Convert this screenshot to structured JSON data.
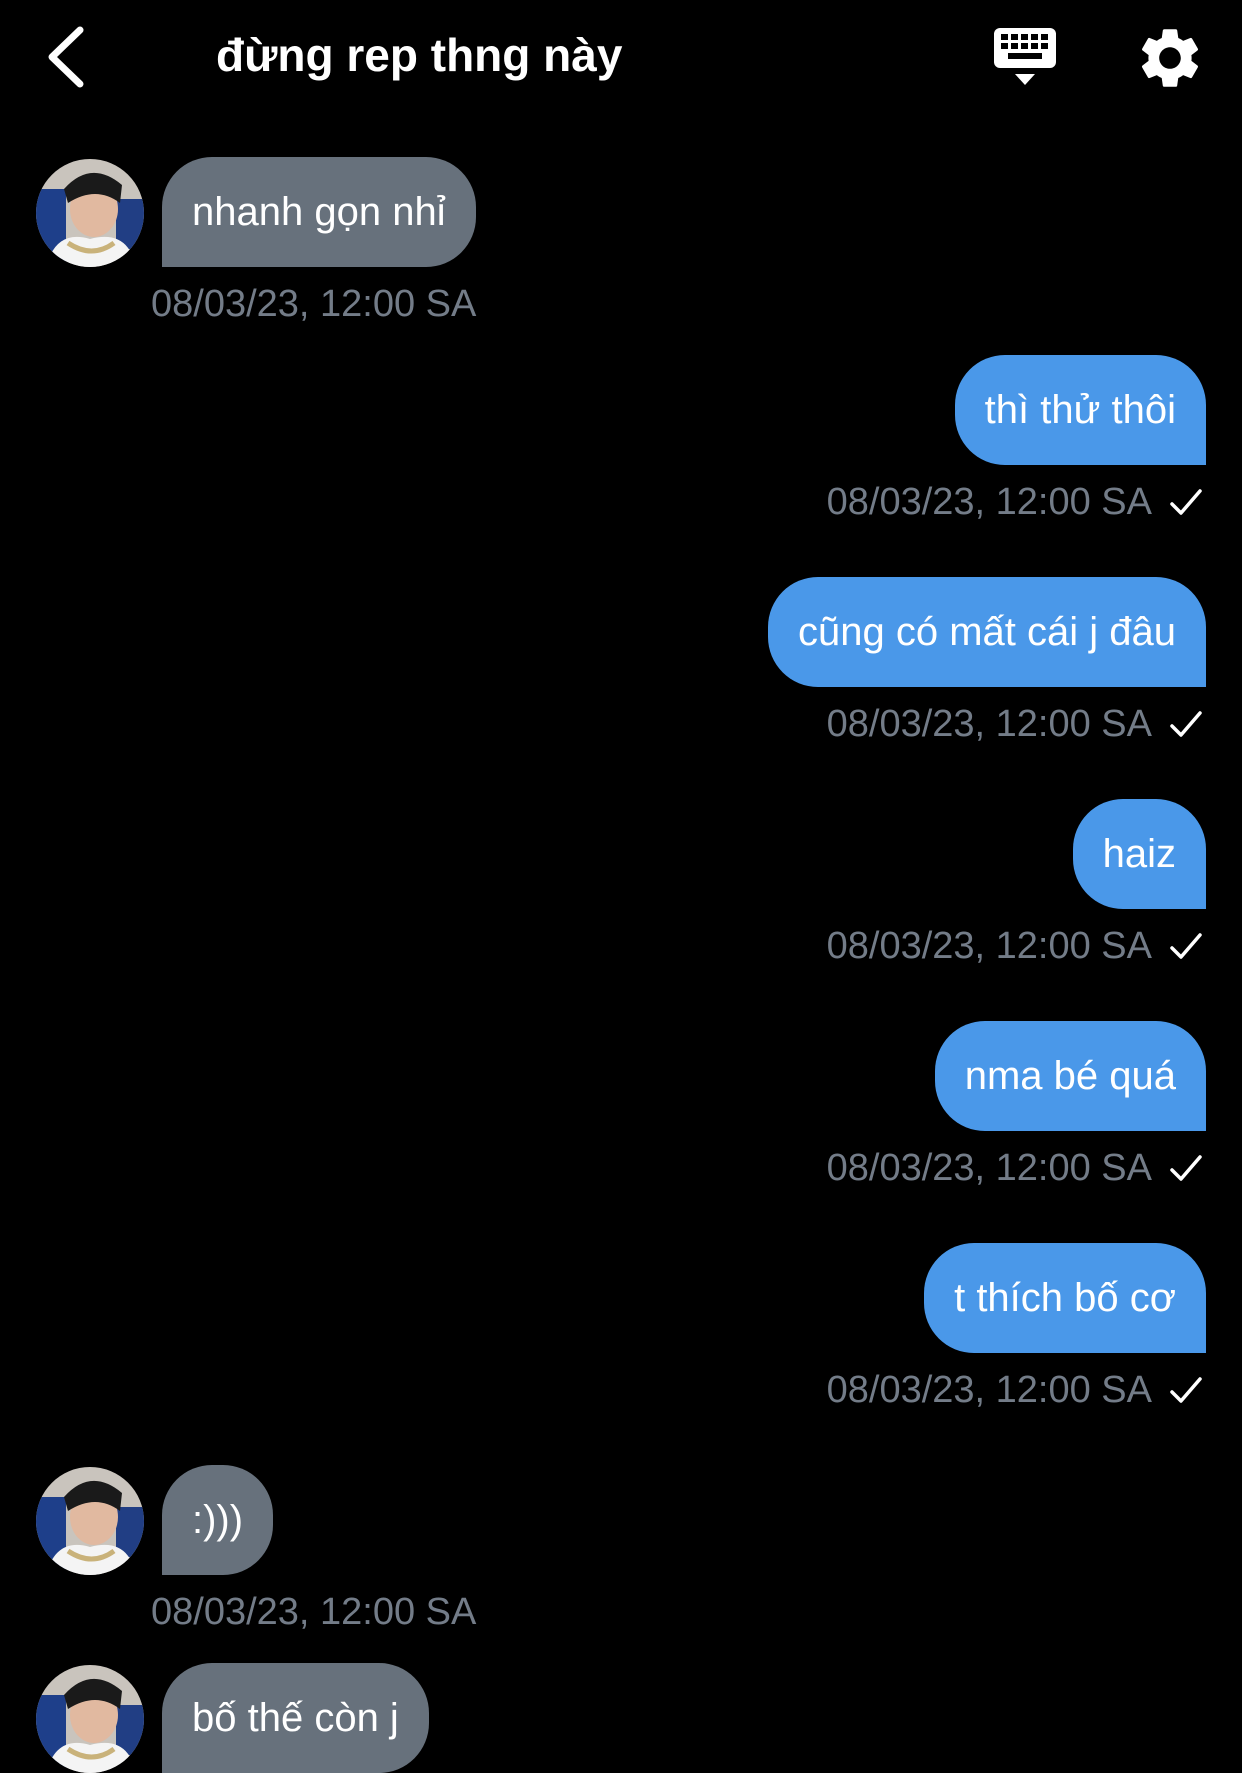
{
  "header": {
    "title": "đừng rep thng này",
    "back_icon": "chevron-left-icon",
    "keyboard_icon": "keyboard-icon",
    "settings_icon": "gear-icon"
  },
  "messages": [
    {
      "direction": "in",
      "text": "nhanh gọn nhỉ",
      "timestamp": "08/03/23, 12:00 SA"
    },
    {
      "direction": "out",
      "text": "thì thử thôi",
      "timestamp": "08/03/23, 12:00 SA",
      "read": true
    },
    {
      "direction": "out",
      "text": "cũng có mất cái j đâu",
      "timestamp": "08/03/23, 12:00 SA",
      "read": true
    },
    {
      "direction": "out",
      "text": "haiz",
      "timestamp": "08/03/23, 12:00 SA",
      "read": true
    },
    {
      "direction": "out",
      "text": "nma bé quá",
      "timestamp": "08/03/23, 12:00 SA",
      "read": true
    },
    {
      "direction": "out",
      "text": "t thích bố cơ",
      "timestamp": "08/03/23, 12:00 SA",
      "read": true
    },
    {
      "direction": "in",
      "text": ":)))",
      "timestamp": "08/03/23, 12:00 SA"
    },
    {
      "direction": "in",
      "text": "bố thế còn j",
      "timestamp": ""
    }
  ],
  "colors": {
    "background": "#000000",
    "incoming_bubble": "#67717c",
    "outgoing_bubble": "#4a98e9",
    "timestamp": "#737c88",
    "text": "#ffffff"
  }
}
